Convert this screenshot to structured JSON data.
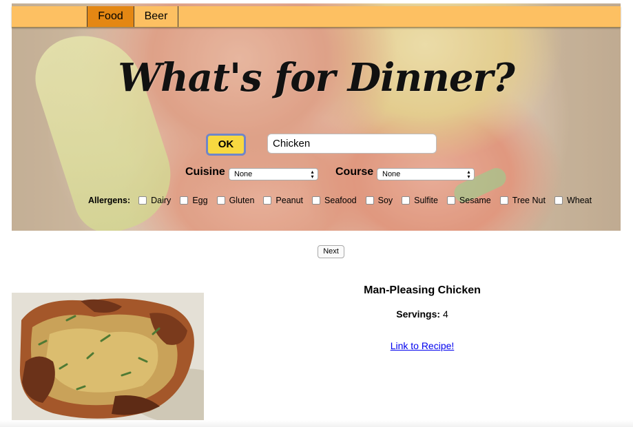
{
  "nav": {
    "tabs": [
      {
        "label": "Food",
        "active": true
      },
      {
        "label": "Beer",
        "active": false
      }
    ]
  },
  "hero": {
    "title": "What's for Dinner?"
  },
  "search": {
    "ok_label": "OK",
    "query_value": "Chicken"
  },
  "filters": {
    "cuisine_label": "Cuisine",
    "cuisine_selected": "None",
    "course_label": "Course",
    "course_selected": "None"
  },
  "allergens": {
    "label": "Allergens:",
    "items": [
      "Dairy",
      "Egg",
      "Gluten",
      "Peanut",
      "Seafood",
      "Soy",
      "Sulfite",
      "Sesame",
      "Tree Nut",
      "Wheat"
    ]
  },
  "pagination": {
    "next_label": "Next"
  },
  "recipe": {
    "title": "Man-Pleasing Chicken",
    "servings_label": "Servings:",
    "servings_value": "4",
    "link_text": "Link to Recipe!",
    "photo_icon": "chicken-photo"
  },
  "colors": {
    "navbar": "#fdc062",
    "active_tab": "#e48713",
    "ok_button": "#f8d840",
    "link": "#0000ee"
  }
}
